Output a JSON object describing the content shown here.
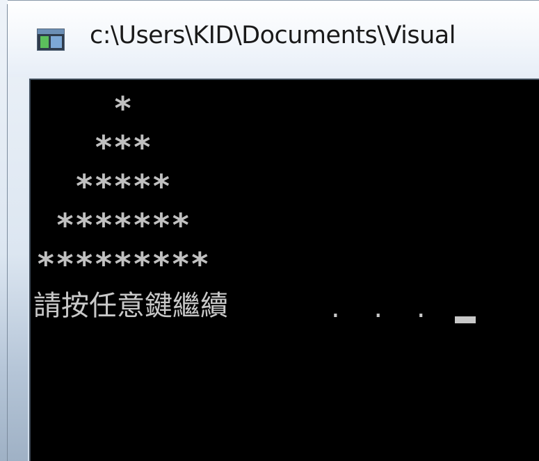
{
  "window": {
    "title": "c:\\Users\\KID\\Documents\\Visual"
  },
  "console": {
    "lines": [
      "    *",
      "   ***",
      "  *****",
      " *******",
      "*********"
    ],
    "prompt": "請按任意鍵繼續",
    "prompt_dots": ". . ."
  },
  "colors": {
    "console_bg": "#000000",
    "console_text": "#c0c0c0",
    "titlebar_bg": "#f5f8fc"
  },
  "icons": {
    "app_icon": "console-window-icon"
  }
}
